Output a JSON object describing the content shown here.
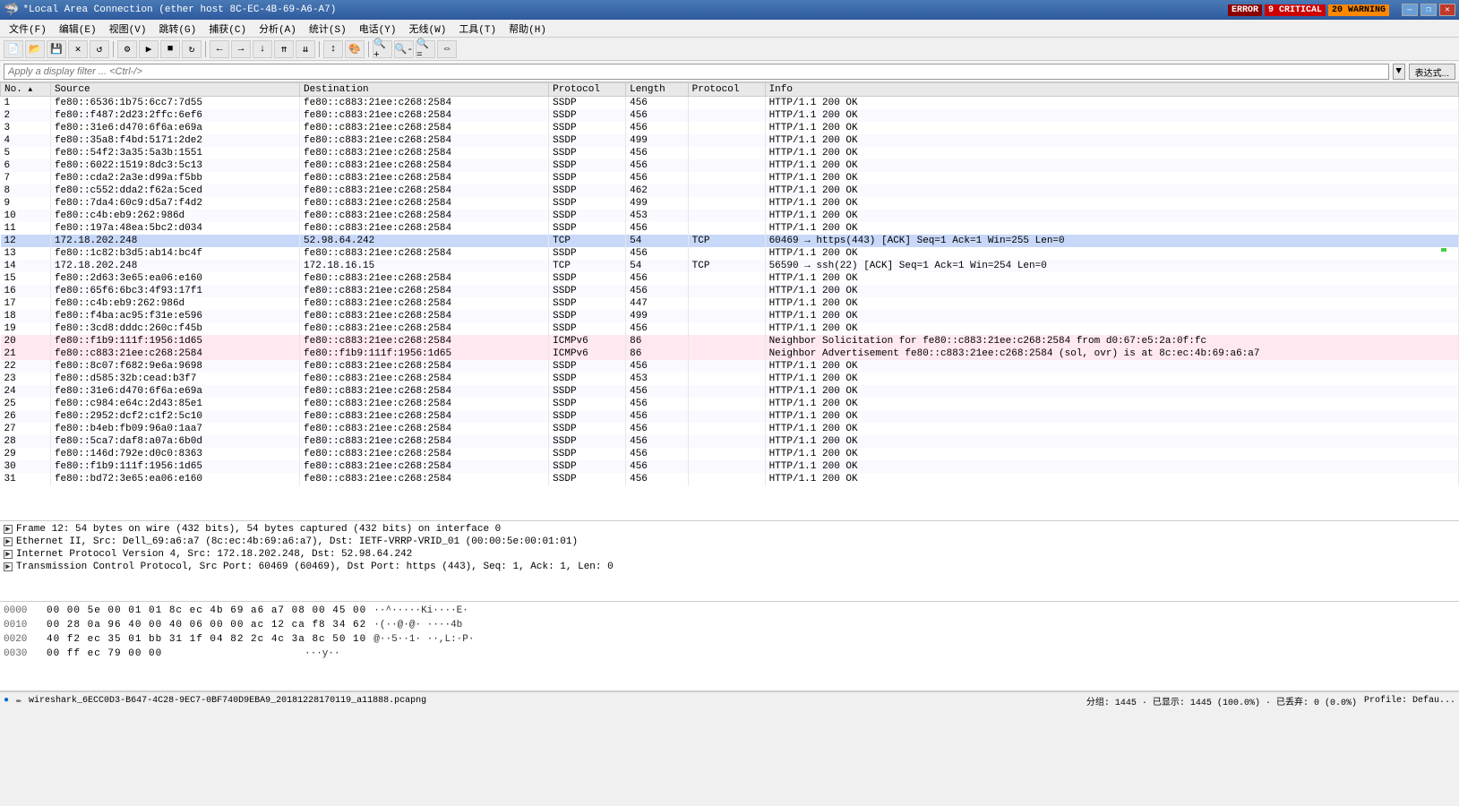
{
  "titlebar": {
    "icon": "🦈",
    "title": "*Local Area Connection (ether host 8C-EC-4B-69-A6-A7)",
    "error_label": "ERROR",
    "critical_count": "9 CRITICAL",
    "warning_label": "20 WARNING",
    "btn_minimize": "—",
    "btn_restore": "❐",
    "btn_close": "✕"
  },
  "menubar": {
    "items": [
      "文件(F)",
      "编辑(E)",
      "视图(V)",
      "跳转(G)",
      "捕获(C)",
      "分析(A)",
      "统计(S)",
      "电话(Y)",
      "无线(W)",
      "工具(T)",
      "帮助(H)"
    ]
  },
  "filterbar": {
    "placeholder": "Apply a display filter ... <Ctrl-/>",
    "btn_label": "表达式..."
  },
  "columns": {
    "no": "No.",
    "source": "Source",
    "destination": "Destination",
    "protocol": "Protocol",
    "length": "Length",
    "protocol2": "Protocol",
    "info": "Info"
  },
  "packets": [
    {
      "no": 1,
      "source": "fe80::6536:1b75:6cc7:7d55",
      "destination": "fe80::c883:21ee:c268:2584",
      "protocol": "SSDP",
      "length": 456,
      "protocol2": "",
      "info": "HTTP/1.1 200 OK",
      "style": "normal"
    },
    {
      "no": 2,
      "source": "fe80::f487:2d23:2ffc:6ef6",
      "destination": "fe80::c883:21ee:c268:2584",
      "protocol": "SSDP",
      "length": 456,
      "protocol2": "",
      "info": "HTTP/1.1 200 OK",
      "style": "normal"
    },
    {
      "no": 3,
      "source": "fe80::31e6:d470:6f6a:e69a",
      "destination": "fe80::c883:21ee:c268:2584",
      "protocol": "SSDP",
      "length": 456,
      "protocol2": "",
      "info": "HTTP/1.1 200 OK",
      "style": "normal"
    },
    {
      "no": 4,
      "source": "fe80::35a8:f4bd:5171:2de2",
      "destination": "fe80::c883:21ee:c268:2584",
      "protocol": "SSDP",
      "length": 499,
      "protocol2": "",
      "info": "HTTP/1.1 200 OK",
      "style": "normal"
    },
    {
      "no": 5,
      "source": "fe80::54f2:3a35:5a3b:1551",
      "destination": "fe80::c883:21ee:c268:2584",
      "protocol": "SSDP",
      "length": 456,
      "protocol2": "",
      "info": "HTTP/1.1 200 OK",
      "style": "normal"
    },
    {
      "no": 6,
      "source": "fe80::6022:1519:8dc3:5c13",
      "destination": "fe80::c883:21ee:c268:2584",
      "protocol": "SSDP",
      "length": 456,
      "protocol2": "",
      "info": "HTTP/1.1 200 OK",
      "style": "normal"
    },
    {
      "no": 7,
      "source": "fe80::cda2:2a3e:d99a:f5bb",
      "destination": "fe80::c883:21ee:c268:2584",
      "protocol": "SSDP",
      "length": 456,
      "protocol2": "",
      "info": "HTTP/1.1 200 OK",
      "style": "normal"
    },
    {
      "no": 8,
      "source": "fe80::c552:dda2:f62a:5ced",
      "destination": "fe80::c883:21ee:c268:2584",
      "protocol": "SSDP",
      "length": 462,
      "protocol2": "",
      "info": "HTTP/1.1 200 OK",
      "style": "normal"
    },
    {
      "no": 9,
      "source": "fe80::7da4:60c9:d5a7:f4d2",
      "destination": "fe80::c883:21ee:c268:2584",
      "protocol": "SSDP",
      "length": 499,
      "protocol2": "",
      "info": "HTTP/1.1 200 OK",
      "style": "normal"
    },
    {
      "no": 10,
      "source": "fe80::c4b:eb9:262:986d",
      "destination": "fe80::c883:21ee:c268:2584",
      "protocol": "SSDP",
      "length": 453,
      "protocol2": "",
      "info": "HTTP/1.1 200 OK",
      "style": "normal"
    },
    {
      "no": 11,
      "source": "fe80::197a:48ea:5bc2:d034",
      "destination": "fe80::c883:21ee:c268:2584",
      "protocol": "SSDP",
      "length": 456,
      "protocol2": "",
      "info": "HTTP/1.1 200 OK",
      "style": "normal"
    },
    {
      "no": 12,
      "source": "172.18.202.248",
      "destination": "52.98.64.242",
      "protocol": "TCP",
      "length": 54,
      "protocol2": "TCP",
      "info": "60469 → https(443)  [ACK] Seq=1 Ack=1 Win=255 Len=0",
      "style": "selected"
    },
    {
      "no": 13,
      "source": "fe80::1c82:b3d5:ab14:bc4f",
      "destination": "fe80::c883:21ee:c268:2584",
      "protocol": "SSDP",
      "length": 456,
      "protocol2": "",
      "info": "HTTP/1.1 200 OK",
      "style": "normal"
    },
    {
      "no": 14,
      "source": "172.18.202.248",
      "destination": "172.18.16.15",
      "protocol": "TCP",
      "length": 54,
      "protocol2": "TCP",
      "info": "56590 → ssh(22)  [ACK] Seq=1 Ack=1 Win=254 Len=0",
      "style": "normal"
    },
    {
      "no": 15,
      "source": "fe80::2d63:3e65:ea06:e160",
      "destination": "fe80::c883:21ee:c268:2584",
      "protocol": "SSDP",
      "length": 456,
      "protocol2": "",
      "info": "HTTP/1.1 200 OK",
      "style": "normal"
    },
    {
      "no": 16,
      "source": "fe80::65f6:6bc3:4f93:17f1",
      "destination": "fe80::c883:21ee:c268:2584",
      "protocol": "SSDP",
      "length": 456,
      "protocol2": "",
      "info": "HTTP/1.1 200 OK",
      "style": "normal"
    },
    {
      "no": 17,
      "source": "fe80::c4b:eb9:262:986d",
      "destination": "fe80::c883:21ee:c268:2584",
      "protocol": "SSDP",
      "length": 447,
      "protocol2": "",
      "info": "HTTP/1.1 200 OK",
      "style": "normal"
    },
    {
      "no": 18,
      "source": "fe80::f4ba:ac95:f31e:e596",
      "destination": "fe80::c883:21ee:c268:2584",
      "protocol": "SSDP",
      "length": 499,
      "protocol2": "",
      "info": "HTTP/1.1 200 OK",
      "style": "normal"
    },
    {
      "no": 19,
      "source": "fe80::3cd8:dddc:260c:f45b",
      "destination": "fe80::c883:21ee:c268:2584",
      "protocol": "SSDP",
      "length": 456,
      "protocol2": "",
      "info": "HTTP/1.1 200 OK",
      "style": "normal"
    },
    {
      "no": 20,
      "source": "fe80::f1b9:111f:1956:1d65",
      "destination": "fe80::c883:21ee:c268:2584",
      "protocol": "ICMPv6",
      "length": 86,
      "protocol2": "",
      "info": "Neighbor Solicitation for fe80::c883:21ee:c268:2584 from d0:67:e5:2a:0f:fc",
      "style": "pink"
    },
    {
      "no": 21,
      "source": "fe80::c883:21ee:c268:2584",
      "destination": "fe80::f1b9:111f:1956:1d65",
      "protocol": "ICMPv6",
      "length": 86,
      "protocol2": "",
      "info": "Neighbor Advertisement fe80::c883:21ee:c268:2584 (sol, ovr) is at 8c:ec:4b:69:a6:a7",
      "style": "pink"
    },
    {
      "no": 22,
      "source": "fe80::8c07:f682:9e6a:9698",
      "destination": "fe80::c883:21ee:c268:2584",
      "protocol": "SSDP",
      "length": 456,
      "protocol2": "",
      "info": "HTTP/1.1 200 OK",
      "style": "normal"
    },
    {
      "no": 23,
      "source": "fe80::d585:32b:cead:b3f7",
      "destination": "fe80::c883:21ee:c268:2584",
      "protocol": "SSDP",
      "length": 453,
      "protocol2": "",
      "info": "HTTP/1.1 200 OK",
      "style": "normal"
    },
    {
      "no": 24,
      "source": "fe80::31e6:d470:6f6a:e69a",
      "destination": "fe80::c883:21ee:c268:2584",
      "protocol": "SSDP",
      "length": 456,
      "protocol2": "",
      "info": "HTTP/1.1 200 OK",
      "style": "normal"
    },
    {
      "no": 25,
      "source": "fe80::c984:e64c:2d43:85e1",
      "destination": "fe80::c883:21ee:c268:2584",
      "protocol": "SSDP",
      "length": 456,
      "protocol2": "",
      "info": "HTTP/1.1 200 OK",
      "style": "normal"
    },
    {
      "no": 26,
      "source": "fe80::2952:dcf2:c1f2:5c10",
      "destination": "fe80::c883:21ee:c268:2584",
      "protocol": "SSDP",
      "length": 456,
      "protocol2": "",
      "info": "HTTP/1.1 200 OK",
      "style": "normal"
    },
    {
      "no": 27,
      "source": "fe80::b4eb:fb09:96a0:1aa7",
      "destination": "fe80::c883:21ee:c268:2584",
      "protocol": "SSDP",
      "length": 456,
      "protocol2": "",
      "info": "HTTP/1.1 200 OK",
      "style": "normal"
    },
    {
      "no": 28,
      "source": "fe80::5ca7:daf8:a07a:6b0d",
      "destination": "fe80::c883:21ee:c268:2584",
      "protocol": "SSDP",
      "length": 456,
      "protocol2": "",
      "info": "HTTP/1.1 200 OK",
      "style": "normal"
    },
    {
      "no": 29,
      "source": "fe80::146d:792e:d0c0:8363",
      "destination": "fe80::c883:21ee:c268:2584",
      "protocol": "SSDP",
      "length": 456,
      "protocol2": "",
      "info": "HTTP/1.1 200 OK",
      "style": "normal"
    },
    {
      "no": 30,
      "source": "fe80::f1b9:111f:1956:1d65",
      "destination": "fe80::c883:21ee:c268:2584",
      "protocol": "SSDP",
      "length": 456,
      "protocol2": "",
      "info": "HTTP/1.1 200 OK",
      "style": "normal"
    },
    {
      "no": 31,
      "source": "fe80::bd72:3e65:ea06:e160",
      "destination": "fe80::c883:21ee:c268:2584",
      "protocol": "SSDP",
      "length": 456,
      "protocol2": "",
      "info": "HTTP/1.1 200 OK",
      "style": "normal"
    }
  ],
  "details": [
    {
      "text": "Frame 12: 54 bytes on wire (432 bits), 54 bytes captured (432 bits) on interface 0",
      "expanded": false
    },
    {
      "text": "Ethernet II, Src: Dell_69:a6:a7 (8c:ec:4b:69:a6:a7), Dst: IETF-VRRP-VRID_01 (00:00:5e:00:01:01)",
      "expanded": false
    },
    {
      "text": "Internet Protocol Version 4, Src: 172.18.202.248, Dst: 52.98.64.242",
      "expanded": false
    },
    {
      "text": "Transmission Control Protocol, Src Port: 60469 (60469), Dst Port: https (443), Seq: 1, Ack: 1, Len: 0",
      "expanded": false
    }
  ],
  "hex_rows": [
    {
      "offset": "0000",
      "bytes": "00 00 5e 00 01 01 8c ec  4b 69 a6 a7 08 00 45 00",
      "ascii": "··^·····Ki····E·"
    },
    {
      "offset": "0010",
      "bytes": "00 28 0a 96 40 00 40 06  00 00 ac 12 ca f8 34 62",
      "ascii": "·(··@·@·  ····4b"
    },
    {
      "offset": "0020",
      "bytes": "40 f2 ec 35 01 bb 31 1f  04 82 2c 4c 3a 8c 50 10",
      "ascii": "@··5··1·  ··,L:·P·"
    },
    {
      "offset": "0030",
      "bytes": "00 ff ec 79 00 00",
      "ascii": "···y··"
    }
  ],
  "statusbar": {
    "left": {
      "icon1": "●",
      "icon2": "✏",
      "filename": "wireshark_6ECC0D3-B647-4C28-9EC7-0BF740D9EBA9_20181228170119_a11888.pcapng"
    },
    "right": {
      "packets": "分组: 1445 · 已显示: 1445 (100.0%) · 已丢弃: 0 (0.0%)",
      "profile": "Profile: Defau..."
    }
  }
}
